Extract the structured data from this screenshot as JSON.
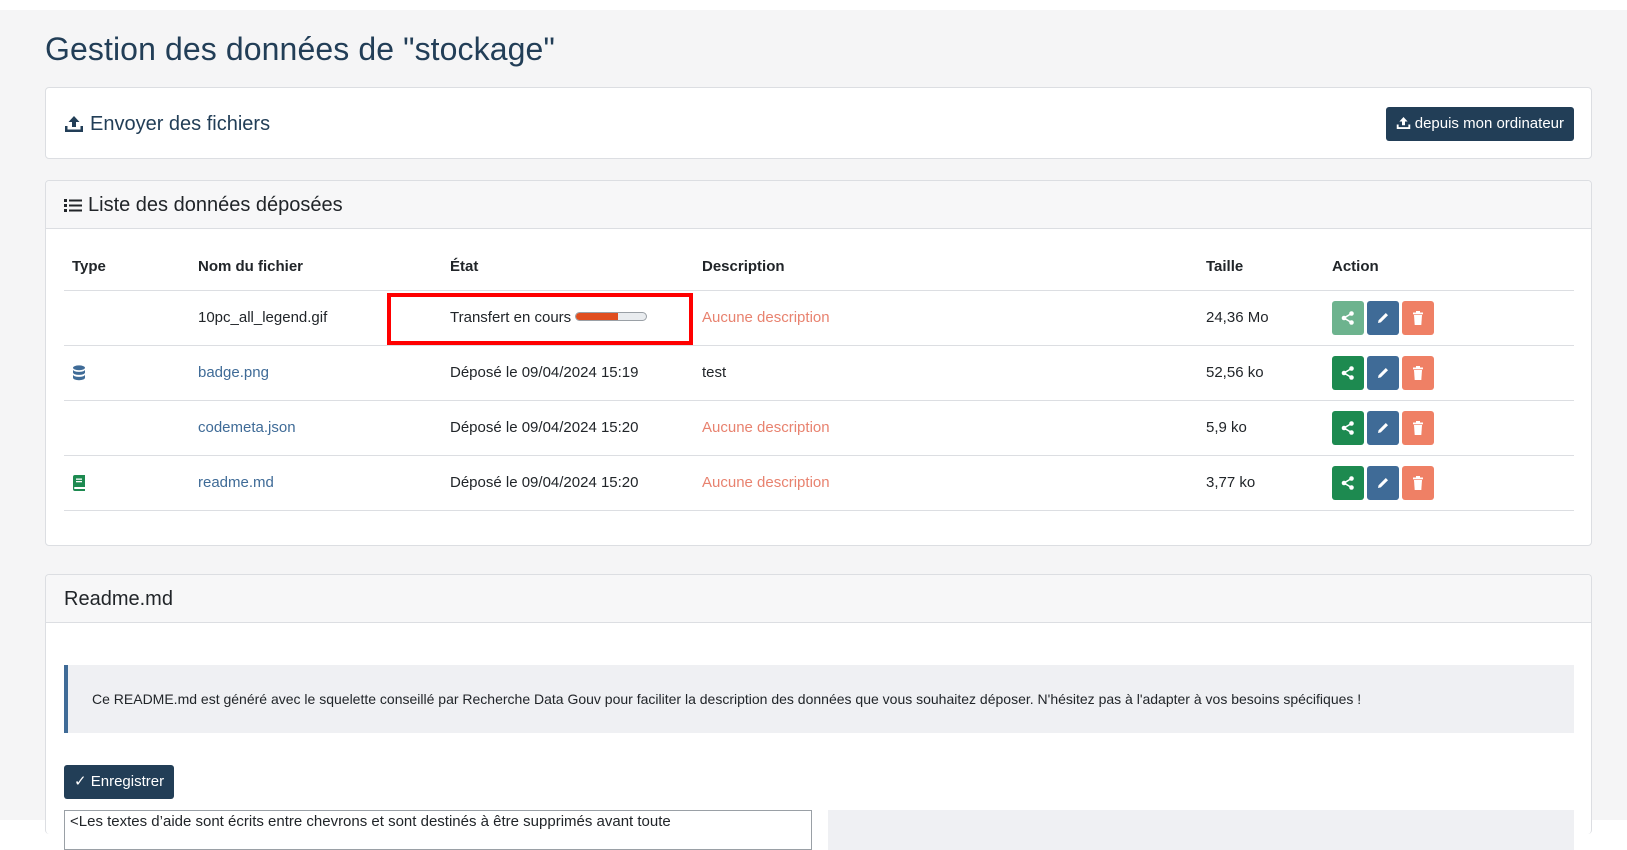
{
  "page": {
    "title": "Gestion des données de \"stockage\""
  },
  "upload": {
    "title": "Envoyer des fichiers",
    "button_label": "depuis mon ordinateur",
    "icon": "upload-icon"
  },
  "list": {
    "title": "Liste des données déposées",
    "icon": "list-icon",
    "columns": [
      "Type",
      "Nom du fichier",
      "État",
      "Description",
      "Taille",
      "Action"
    ],
    "rows": [
      {
        "type_icon": "",
        "name": "10pc_all_legend.gif",
        "state": "Transfert en cours",
        "progress": 0.6,
        "description": "Aucune description",
        "size": "24,36 Mo",
        "share_disabled": true
      },
      {
        "type_icon": "database-icon",
        "name": "badge.png",
        "state": "Déposé le 09/04/2024 15:19",
        "description": "test",
        "size": "52,56 ko",
        "share_disabled": false
      },
      {
        "type_icon": "",
        "name": "codemeta.json",
        "state": "Déposé le 09/04/2024 15:20",
        "description": "Aucune description",
        "size": "5,9 ko",
        "share_disabled": false
      },
      {
        "type_icon": "book-icon",
        "name": "readme.md",
        "state": "Déposé le 09/04/2024 15:20",
        "description": "Aucune description",
        "size": "3,77 ko",
        "share_disabled": false
      }
    ]
  },
  "readme": {
    "title": "Readme.md",
    "info": "Ce README.md est généré avec le squelette conseillé par Recherche Data Gouv pour faciliter la description des données que vous souhaitez déposer. N'hésitez pas à l'adapter à vos besoins spécifiques !",
    "save_label": "Enregistrer",
    "editor_text": "<Les textes d’aide sont écrits entre chevrons et sont destinés à être supprimés avant toute"
  },
  "colors": {
    "primary": "#223e57",
    "link": "#3f6b97",
    "share": "#1d8a50",
    "delete": "#ef8065",
    "no_description": "#e8826f",
    "progress": "#e04e1f",
    "highlight": "#ff0000"
  }
}
